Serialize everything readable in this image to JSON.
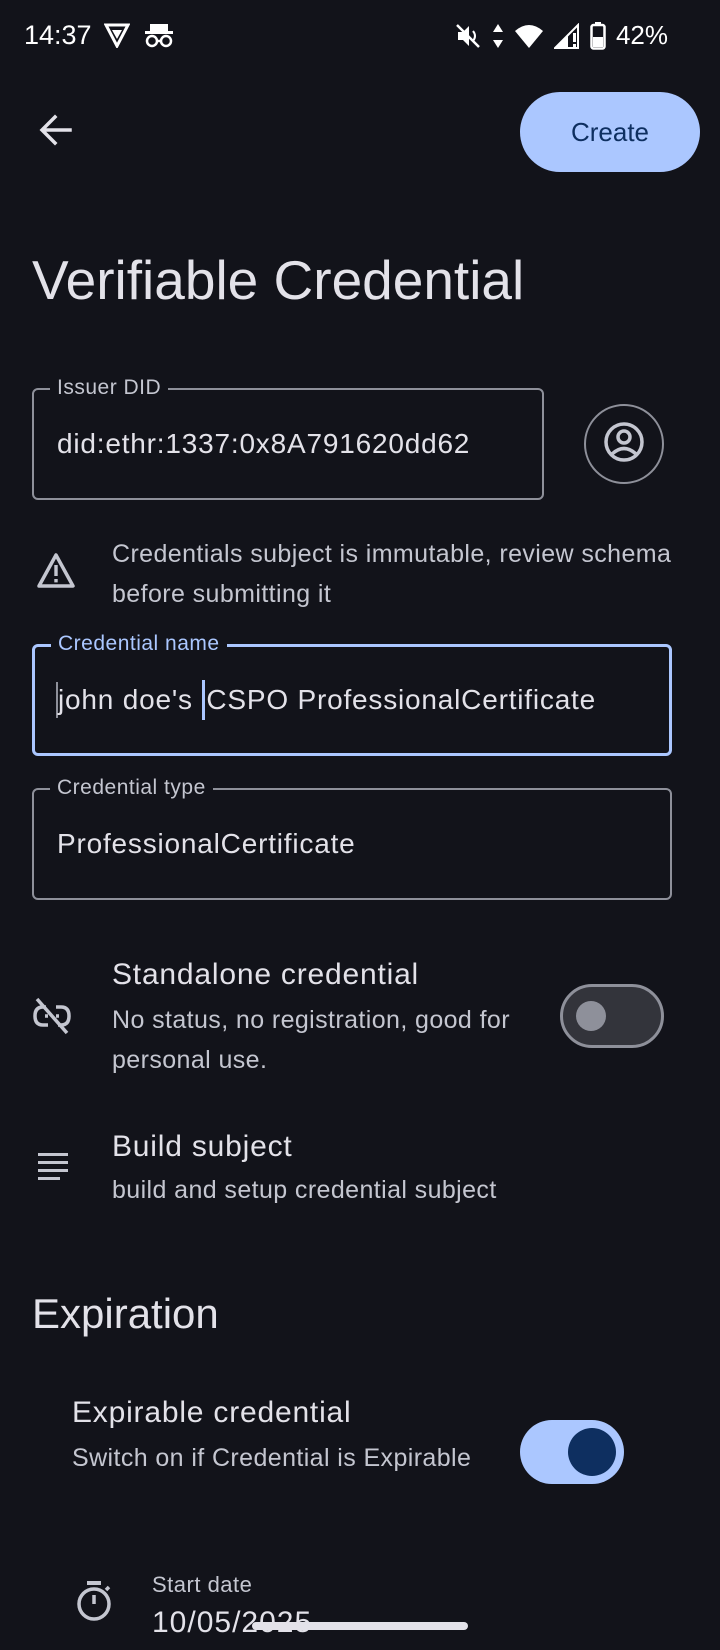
{
  "status_bar": {
    "time": "14:37",
    "battery": "42%"
  },
  "app_bar": {
    "back_icon": "arrow-back-icon",
    "create_label": "Create"
  },
  "page": {
    "title": "Verifiable Credential"
  },
  "issuer": {
    "label": "Issuer DID",
    "value": "did:ethr:1337:0x8A791620dd62",
    "icon": "account-circle-icon"
  },
  "warning": {
    "icon": "warning-icon",
    "text": "Credentials subject is immutable, review schema before submitting it"
  },
  "credential_name": {
    "label": "Credential name",
    "value_before_caret": "john doe's ",
    "value_after_caret": "CSPO ProfessionalCertificate"
  },
  "credential_type": {
    "label": "Credential type",
    "value": "ProfessionalCertificate"
  },
  "standalone": {
    "icon": "link-off-icon",
    "title": "Standalone credential",
    "subtitle": "No status, no registration, good for personal use.",
    "enabled": false
  },
  "build_subject": {
    "icon": "notes-icon",
    "title": "Build subject",
    "subtitle": "build and setup credential subject"
  },
  "expiration": {
    "section_title": "Expiration",
    "expirable_title": "Expirable credential",
    "expirable_subtitle": "Switch on if Credential is Expirable",
    "enabled": true,
    "start_icon": "timer-icon",
    "start_label": "Start date",
    "start_value": "10/05/2025"
  },
  "colors": {
    "background": "#12131a",
    "accent": "#abc7ff",
    "on_accent": "#0e2f60"
  }
}
